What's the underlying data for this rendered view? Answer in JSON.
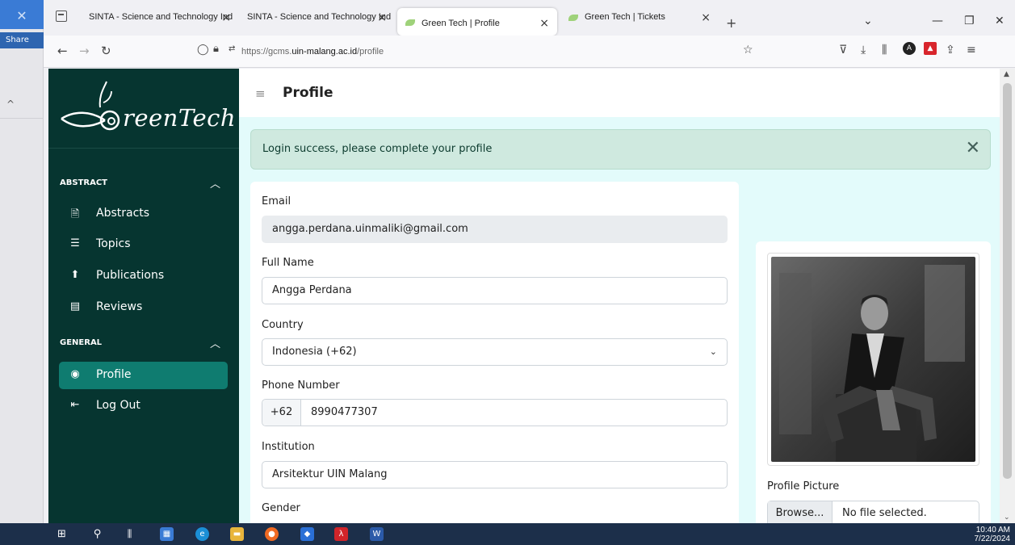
{
  "left_strip": {
    "share_label": "Share"
  },
  "browser": {
    "tabs": [
      {
        "title": "SINTA - Science and Technology Ind",
        "active": false
      },
      {
        "title": "SINTA - Science and Technology Ind",
        "active": false
      },
      {
        "title": "Green Tech | Profile",
        "active": true
      },
      {
        "title": "Green Tech | Tickets",
        "active": false
      }
    ],
    "url_prefix": "https://gcms.",
    "url_domain": "uin-malang.ac.id",
    "url_path": "/profile"
  },
  "sidebar": {
    "logo_text": "reenTech",
    "sections": [
      {
        "title": "ABSTRACT",
        "items": [
          {
            "label": "Abstracts",
            "icon": "file-icon"
          },
          {
            "label": "Topics",
            "icon": "list-icon"
          },
          {
            "label": "Publications",
            "icon": "upload-circle-icon"
          },
          {
            "label": "Reviews",
            "icon": "chat-icon"
          }
        ]
      },
      {
        "title": "GENERAL",
        "items": [
          {
            "label": "Profile",
            "icon": "user-circle-icon",
            "active": true
          },
          {
            "label": "Log Out",
            "icon": "logout-icon"
          }
        ]
      }
    ]
  },
  "header": {
    "title": "Profile"
  },
  "alert": {
    "message": "Login success, please complete your profile"
  },
  "form": {
    "email_label": "Email",
    "email_value": "angga.perdana.uinmaliki@gmail.com",
    "fullname_label": "Full Name",
    "fullname_value": "Angga Perdana",
    "country_label": "Country",
    "country_value": "Indonesia (+62)",
    "phone_label": "Phone Number",
    "phone_prefix": "+62",
    "phone_value": "8990477307",
    "institution_label": "Institution",
    "institution_value": "Arsitektur UIN Malang",
    "gender_label": "Gender"
  },
  "picture": {
    "label": "Profile Picture",
    "browse_label": "Browse...",
    "file_status": "No file selected."
  },
  "taskbar": {
    "time": "10:40 AM",
    "date": "7/22/2024"
  },
  "colors": {
    "sidebar": "#063530",
    "active_item": "#0f7c70",
    "content_bg": "#e3fbfb",
    "alert_bg": "#cfe9df"
  }
}
